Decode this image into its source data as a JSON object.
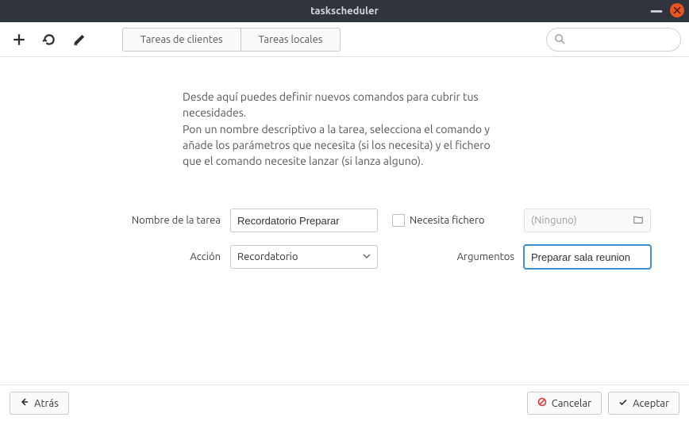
{
  "titlebar": {
    "title": "taskscheduler"
  },
  "toolbar": {
    "tabs": {
      "clients": "Tareas de clientes",
      "local": "Tareas locales"
    },
    "search_placeholder": ""
  },
  "description": {
    "p1": "Desde aquí puedes definir nuevos comandos para cubrir tus necesidades.",
    "p2": "Pon un nombre descriptivo a la tarea, selecciona el comando y añade los parámetros que necesita (si los necesita) y el fichero que el comando necesite lanzar (si lanza alguno)."
  },
  "form": {
    "task_name_label": "Nombre de la tarea",
    "task_name_value": "Recordatorio Preparar",
    "action_label": "Acción",
    "action_value": "Recordatorio",
    "needs_file_label": "Necesita fichero",
    "file_placeholder": "(Ninguno)",
    "arguments_label": "Argumentos",
    "arguments_value": "Preparar sala reunion"
  },
  "footer": {
    "back": "Atrás",
    "cancel": "Cancelar",
    "accept": "Aceptar"
  }
}
